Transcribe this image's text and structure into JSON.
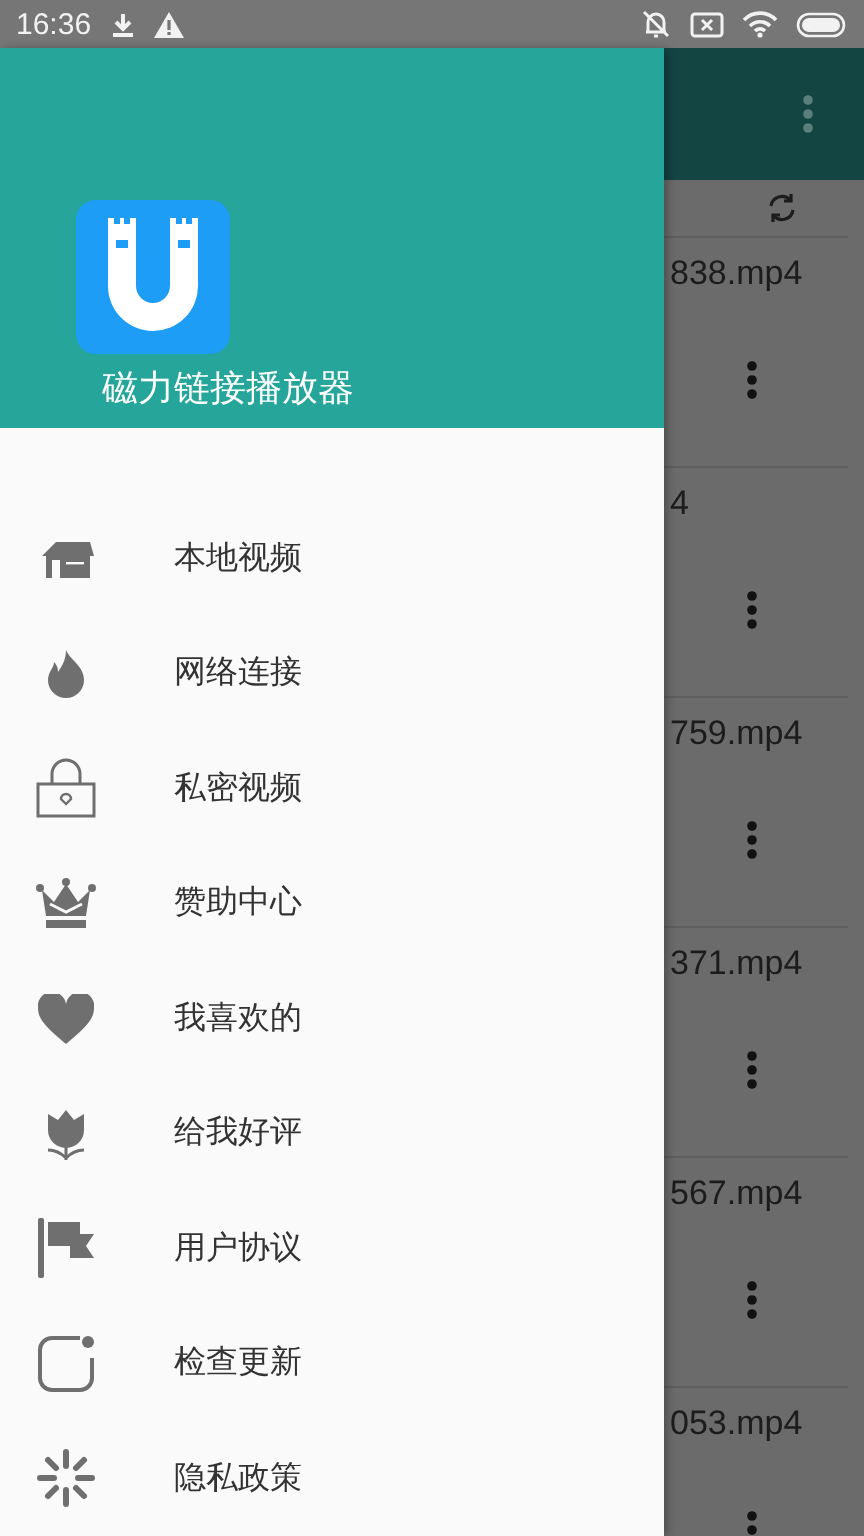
{
  "status_bar": {
    "time": "16:36"
  },
  "drawer": {
    "title": "磁力链接播放器",
    "items": [
      {
        "label": "本地视频"
      },
      {
        "label": "网络连接"
      },
      {
        "label": "私密视频"
      },
      {
        "label": "赞助中心"
      },
      {
        "label": "我喜欢的"
      },
      {
        "label": "给我好评"
      },
      {
        "label": "用户协议"
      },
      {
        "label": "检查更新"
      },
      {
        "label": "隐私政策"
      }
    ]
  },
  "file_list": {
    "files": [
      {
        "name": "838.mp4"
      },
      {
        "name": "4"
      },
      {
        "name": "759.mp4"
      },
      {
        "name": "371.mp4"
      },
      {
        "name": "567.mp4"
      },
      {
        "name": "053.mp4"
      }
    ]
  }
}
